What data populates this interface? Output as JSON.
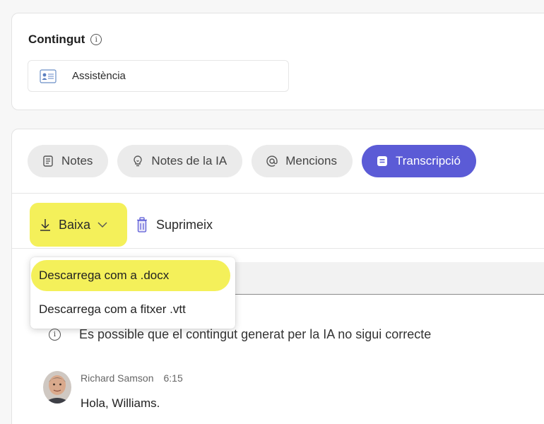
{
  "content_section": {
    "title": "Contingut",
    "attachment_label": "Assistència"
  },
  "tabs": [
    {
      "label": "Notes",
      "icon": "notes-icon",
      "active": false
    },
    {
      "label": "Notes de la IA",
      "icon": "lightbulb-icon",
      "active": false
    },
    {
      "label": "Mencions",
      "icon": "at-icon",
      "active": false
    },
    {
      "label": "Transcripció",
      "icon": "transcript-icon",
      "active": true
    }
  ],
  "toolbar": {
    "download_label": "Baixa",
    "delete_label": "Suprimeix"
  },
  "download_menu": {
    "items": [
      "Descarrega com a .docx",
      "Descarrega com a fitxer .vtt"
    ]
  },
  "ai_notice": "És possible que el contingut generat per la IA no sigui correcte",
  "transcript": {
    "speaker": "Richard Samson",
    "time": "6:15",
    "text": "Hola, Williams."
  },
  "colors": {
    "accent": "#5b5bd6",
    "highlight": "#f4f05a",
    "tab_bg": "#ebebeb"
  }
}
